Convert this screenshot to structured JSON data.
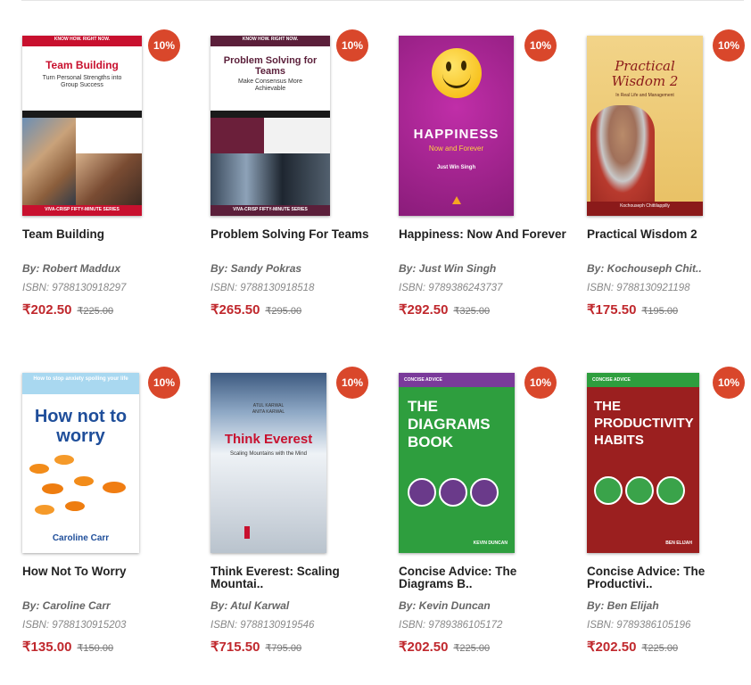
{
  "products": [
    {
      "title": "Team Building",
      "author": "By: Robert Maddux",
      "isbn": "ISBN: 9788130918297",
      "price": "₹202.50",
      "mrp": "₹225.00",
      "discount": "10%",
      "cover": {
        "top_banner": "KNOW HOW. RIGHT NOW.",
        "heading": "Team Building",
        "sub": "Turn Personal Strengths into Group Success",
        "series": "VIVA-CRISP FIFTY-MINUTE SERIES"
      }
    },
    {
      "title": "Problem Solving For Teams",
      "author": "By: Sandy Pokras",
      "isbn": "ISBN: 9788130918518",
      "price": "₹265.50",
      "mrp": "₹295.00",
      "discount": "10%",
      "cover": {
        "top_banner": "KNOW HOW. RIGHT NOW.",
        "heading": "Problem Solving for Teams",
        "sub": "Make Consensus More Achievable",
        "series": "VIVA-CRISP FIFTY-MINUTE SERIES"
      }
    },
    {
      "title": "Happiness: Now And Forever",
      "author": "By: Just Win Singh",
      "isbn": "ISBN: 9789386243737",
      "price": "₹292.50",
      "mrp": "₹325.00",
      "discount": "10%",
      "cover": {
        "heading": "HAPPINESS",
        "sub": "Now and Forever",
        "byline": "Just Win Singh"
      }
    },
    {
      "title": "Practical Wisdom 2",
      "author": "By: Kochouseph Chit..",
      "isbn": "ISBN: 9788130921198",
      "price": "₹175.50",
      "mrp": "₹195.00",
      "discount": "10%",
      "cover": {
        "heading": "Practical Wisdom 2",
        "sub": "In Real Life and Management",
        "byline": "Kochouseph Chittilappilly"
      }
    },
    {
      "title": "How Not To Worry",
      "author": "By: Caroline Carr",
      "isbn": "ISBN: 9788130915203",
      "price": "₹135.00",
      "mrp": "₹150.00",
      "discount": "10%",
      "cover": {
        "top_banner": "How to stop anxiety spoiling your life",
        "heading": "How not to worry",
        "byline": "Caroline Carr"
      }
    },
    {
      "title": "Think Everest: Scaling Mountai..",
      "author": "By: Atul Karwal",
      "isbn": "ISBN: 9788130919546",
      "price": "₹715.50",
      "mrp": "₹795.00",
      "discount": "10%",
      "cover": {
        "top_banner": "ATUL KARWAL\nANITA KARWAL",
        "heading": "Think Everest",
        "sub": "Scaling Mountains with the Mind"
      }
    },
    {
      "title": "Concise Advice: The Diagrams B..",
      "author": "By: Kevin Duncan",
      "isbn": "ISBN: 9789386105172",
      "price": "₹202.50",
      "mrp": "₹225.00",
      "discount": "10%",
      "cover": {
        "top_banner": "CONCISE ADVICE",
        "heading": "THE DIAGRAMS BOOK",
        "byline": "KEVIN DUNCAN"
      }
    },
    {
      "title": "Concise Advice: The Productivi..",
      "author": "By: Ben Elijah",
      "isbn": "ISBN: 9789386105196",
      "price": "₹202.50",
      "mrp": "₹225.00",
      "discount": "10%",
      "cover": {
        "top_banner": "CONCISE ADVICE",
        "heading": "THE PRODUCTIVITY HABITS",
        "byline": "BEN ELIJAH"
      }
    }
  ],
  "colors": {
    "badge": "#d9472b",
    "price": "#c0282d"
  }
}
